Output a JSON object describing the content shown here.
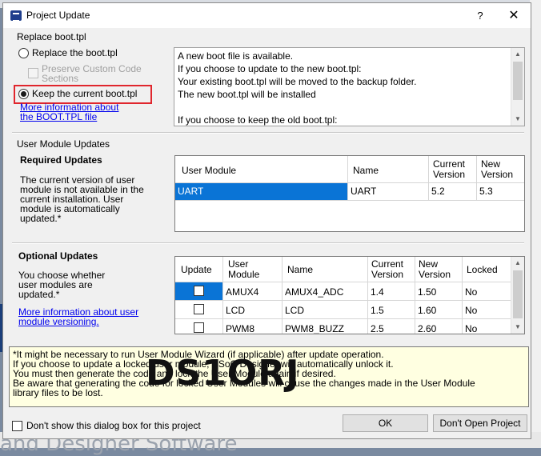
{
  "window": {
    "title": "Project Update",
    "help_glyph": "?",
    "close_glyph": "✕"
  },
  "background": {
    "bottom_text": "and Designer Software"
  },
  "replace_boot": {
    "group_label": "Replace boot.tpl",
    "option_replace": "Replace the boot.tpl",
    "preserve_line1": "Preserve Custom Code",
    "preserve_line2": "Sections",
    "option_keep": "Keep the current boot.tpl",
    "more_info_line1": "More information about",
    "more_info_line2": "the BOOT.TPL file",
    "message_lines": [
      "A new boot file is available.",
      "If you choose to update to the new boot.tpl:",
      "Your existing boot.tpl will be moved to the backup folder.",
      "The new boot.tpl will be installed",
      "",
      "If you choose to keep the old boot.tpl:"
    ]
  },
  "user_module_updates": {
    "group_label": "User Module Updates",
    "required": {
      "heading": "Required Updates",
      "desc_lines": [
        "The current version of user",
        "module is not available in the",
        "current installation.  User",
        "module is automatically",
        "updated.*"
      ],
      "columns": {
        "user_module": "User Module",
        "name": "Name",
        "current_version_1": "Current",
        "current_version_2": "Version",
        "new_version_1": "New",
        "new_version_2": "Version"
      },
      "rows": [
        {
          "user_module": "UART",
          "name": "UART",
          "current": "5.2",
          "new": "5.3"
        }
      ]
    },
    "optional": {
      "heading": "Optional Updates",
      "desc_lines": [
        "You choose whether",
        "user modules are",
        "updated.*"
      ],
      "more_info_line1": "More information about user",
      "more_info_line2": "module versioning.",
      "columns": {
        "update": "Update",
        "user_module_1": "User",
        "user_module_2": "Module",
        "name": "Name",
        "current_1": "Current",
        "current_2": "Version",
        "new_1": "New",
        "new_2": "Version",
        "locked": "Locked"
      },
      "rows": [
        {
          "user_module": "AMUX4",
          "name": "AMUX4_ADC",
          "current": "1.4",
          "new": "1.50",
          "locked": "No"
        },
        {
          "user_module": "LCD",
          "name": "LCD",
          "current": "1.5",
          "new": "1.60",
          "locked": "No"
        },
        {
          "user_module": "PWM8",
          "name": "PWM8_BUZZ",
          "current": "2.5",
          "new": "2.60",
          "locked": "No"
        }
      ]
    }
  },
  "notes": {
    "lines": [
      "*It might be necessary to run User Module Wizard (if applicable) after update operation.",
      "If you choose to update a locked user module, PSoC Designer will automatically unlock it.",
      "You must then generate the code and lock the User Module again if desired.",
      "Be aware that generating the code for locked User Modules will cause the changes made in the User Module",
      "library files to be lost."
    ],
    "watermark": "DS1ORJ"
  },
  "footer": {
    "dont_show": "Don't show this dialog box for this project",
    "ok": "OK",
    "dont_open": "Don't Open Project"
  },
  "colors": {
    "selection": "#0a74d6",
    "highlight_box": "#e0262d",
    "notes_bg": "#ffffe1"
  }
}
